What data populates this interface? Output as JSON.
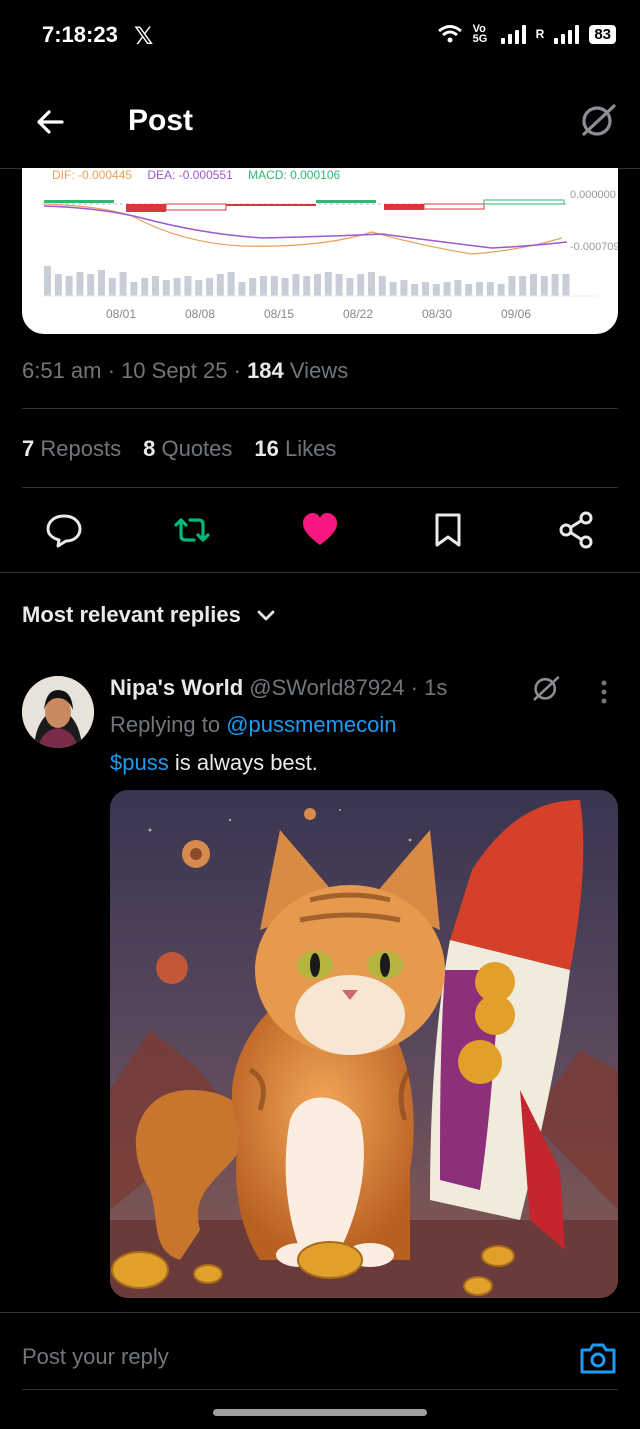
{
  "status_bar": {
    "time": "7:18:23",
    "x_logo": "𝕏",
    "network": "Vo 5G",
    "roaming": "R",
    "battery": "83"
  },
  "header": {
    "title": "Post",
    "back_icon": "arrow-left-icon",
    "grok_icon": "grok-icon"
  },
  "chart": {
    "dif_label": "DIF: -0.000445",
    "dea_label": "DEA: -0.000551",
    "macd_label": "MACD: 0.000106",
    "right_top": "0.000000",
    "right_bottom": "-0.000709",
    "dates": [
      "08/01",
      "08/08",
      "08/15",
      "08/22",
      "08/30",
      "09/06"
    ]
  },
  "meta": {
    "time": "6:51 am",
    "date": "10 Sept 25",
    "views_count": "184",
    "views_label": "Views"
  },
  "stats": {
    "reposts_count": "7",
    "reposts_label": "Reposts",
    "quotes_count": "8",
    "quotes_label": "Quotes",
    "likes_count": "16",
    "likes_label": "Likes"
  },
  "actions": {
    "reply_icon": "reply-icon",
    "repost_icon": "repost-icon",
    "like_icon": "heart-icon",
    "bookmark_icon": "bookmark-icon",
    "share_icon": "share-icon",
    "repost_color": "#00ba7c",
    "like_color": "#f91880"
  },
  "replies": {
    "sort_label": "Most relevant replies",
    "items": [
      {
        "name": "Nipa's World",
        "handle": "@SWorld87924",
        "time": "1s",
        "replying_prefix": "Replying to",
        "replying_to": "@pussmemecoin",
        "cashtag": "$puss",
        "text": " is always best."
      }
    ]
  },
  "composer": {
    "placeholder": "Post your reply",
    "camera_icon": "camera-icon"
  }
}
